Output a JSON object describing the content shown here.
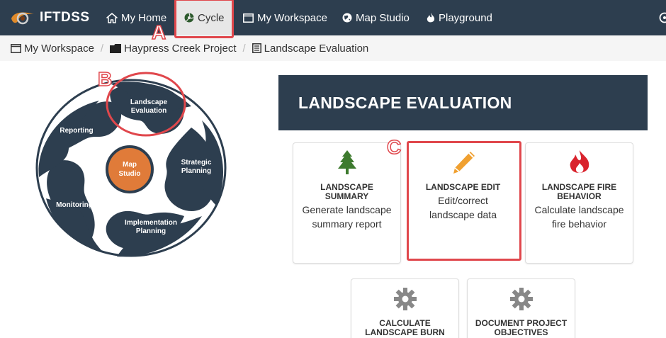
{
  "nav": {
    "brand": "IFTDSS",
    "items": [
      {
        "label": "My Home",
        "icon": "home-icon"
      },
      {
        "label": "Cycle",
        "icon": "cycle-icon"
      },
      {
        "label": "My Workspace",
        "icon": "window-icon"
      },
      {
        "label": "Map Studio",
        "icon": "globe-icon"
      },
      {
        "label": "Playground",
        "icon": "fire-icon"
      }
    ]
  },
  "breadcrumb": [
    {
      "label": "My Workspace",
      "icon": "window-icon"
    },
    {
      "label": "Haypress Creek Project",
      "icon": "folder-icon"
    },
    {
      "label": "Landscape Evaluation",
      "icon": "list-icon"
    }
  ],
  "cycle": {
    "center": "Map\nStudio",
    "segments": [
      "Landscape\nEvaluation",
      "Strategic\nPlanning",
      "Implementation\nPlanning",
      "Monitoring",
      "Reporting"
    ]
  },
  "header": {
    "title": "LANDSCAPE EVALUATION"
  },
  "cards": [
    {
      "title": "LANDSCAPE SUMMARY",
      "desc": "Generate landscape summary report",
      "icon": "tree-icon"
    },
    {
      "title": "LANDSCAPE EDIT",
      "desc": "Edit/correct landscape data",
      "icon": "pencil-icon"
    },
    {
      "title": "LANDSCAPE FIRE BEHAVIOR",
      "desc": "Calculate landscape fire behavior",
      "icon": "fire-icon"
    },
    {
      "title": "CALCULATE LANDSCAPE BURN",
      "desc": "",
      "icon": "gear-icon"
    },
    {
      "title": "DOCUMENT PROJECT OBJECTIVES",
      "desc": "",
      "icon": "gear-icon"
    }
  ],
  "annotations": {
    "a": "A",
    "b": "B",
    "c": "C"
  },
  "colors": {
    "navbar": "#2d3e4f",
    "accent": "#e0474c",
    "map_studio": "#e07b39",
    "tree": "#3d7a2e",
    "pencil": "#f0a030",
    "fire": "#d9232d",
    "gear": "#888888"
  }
}
